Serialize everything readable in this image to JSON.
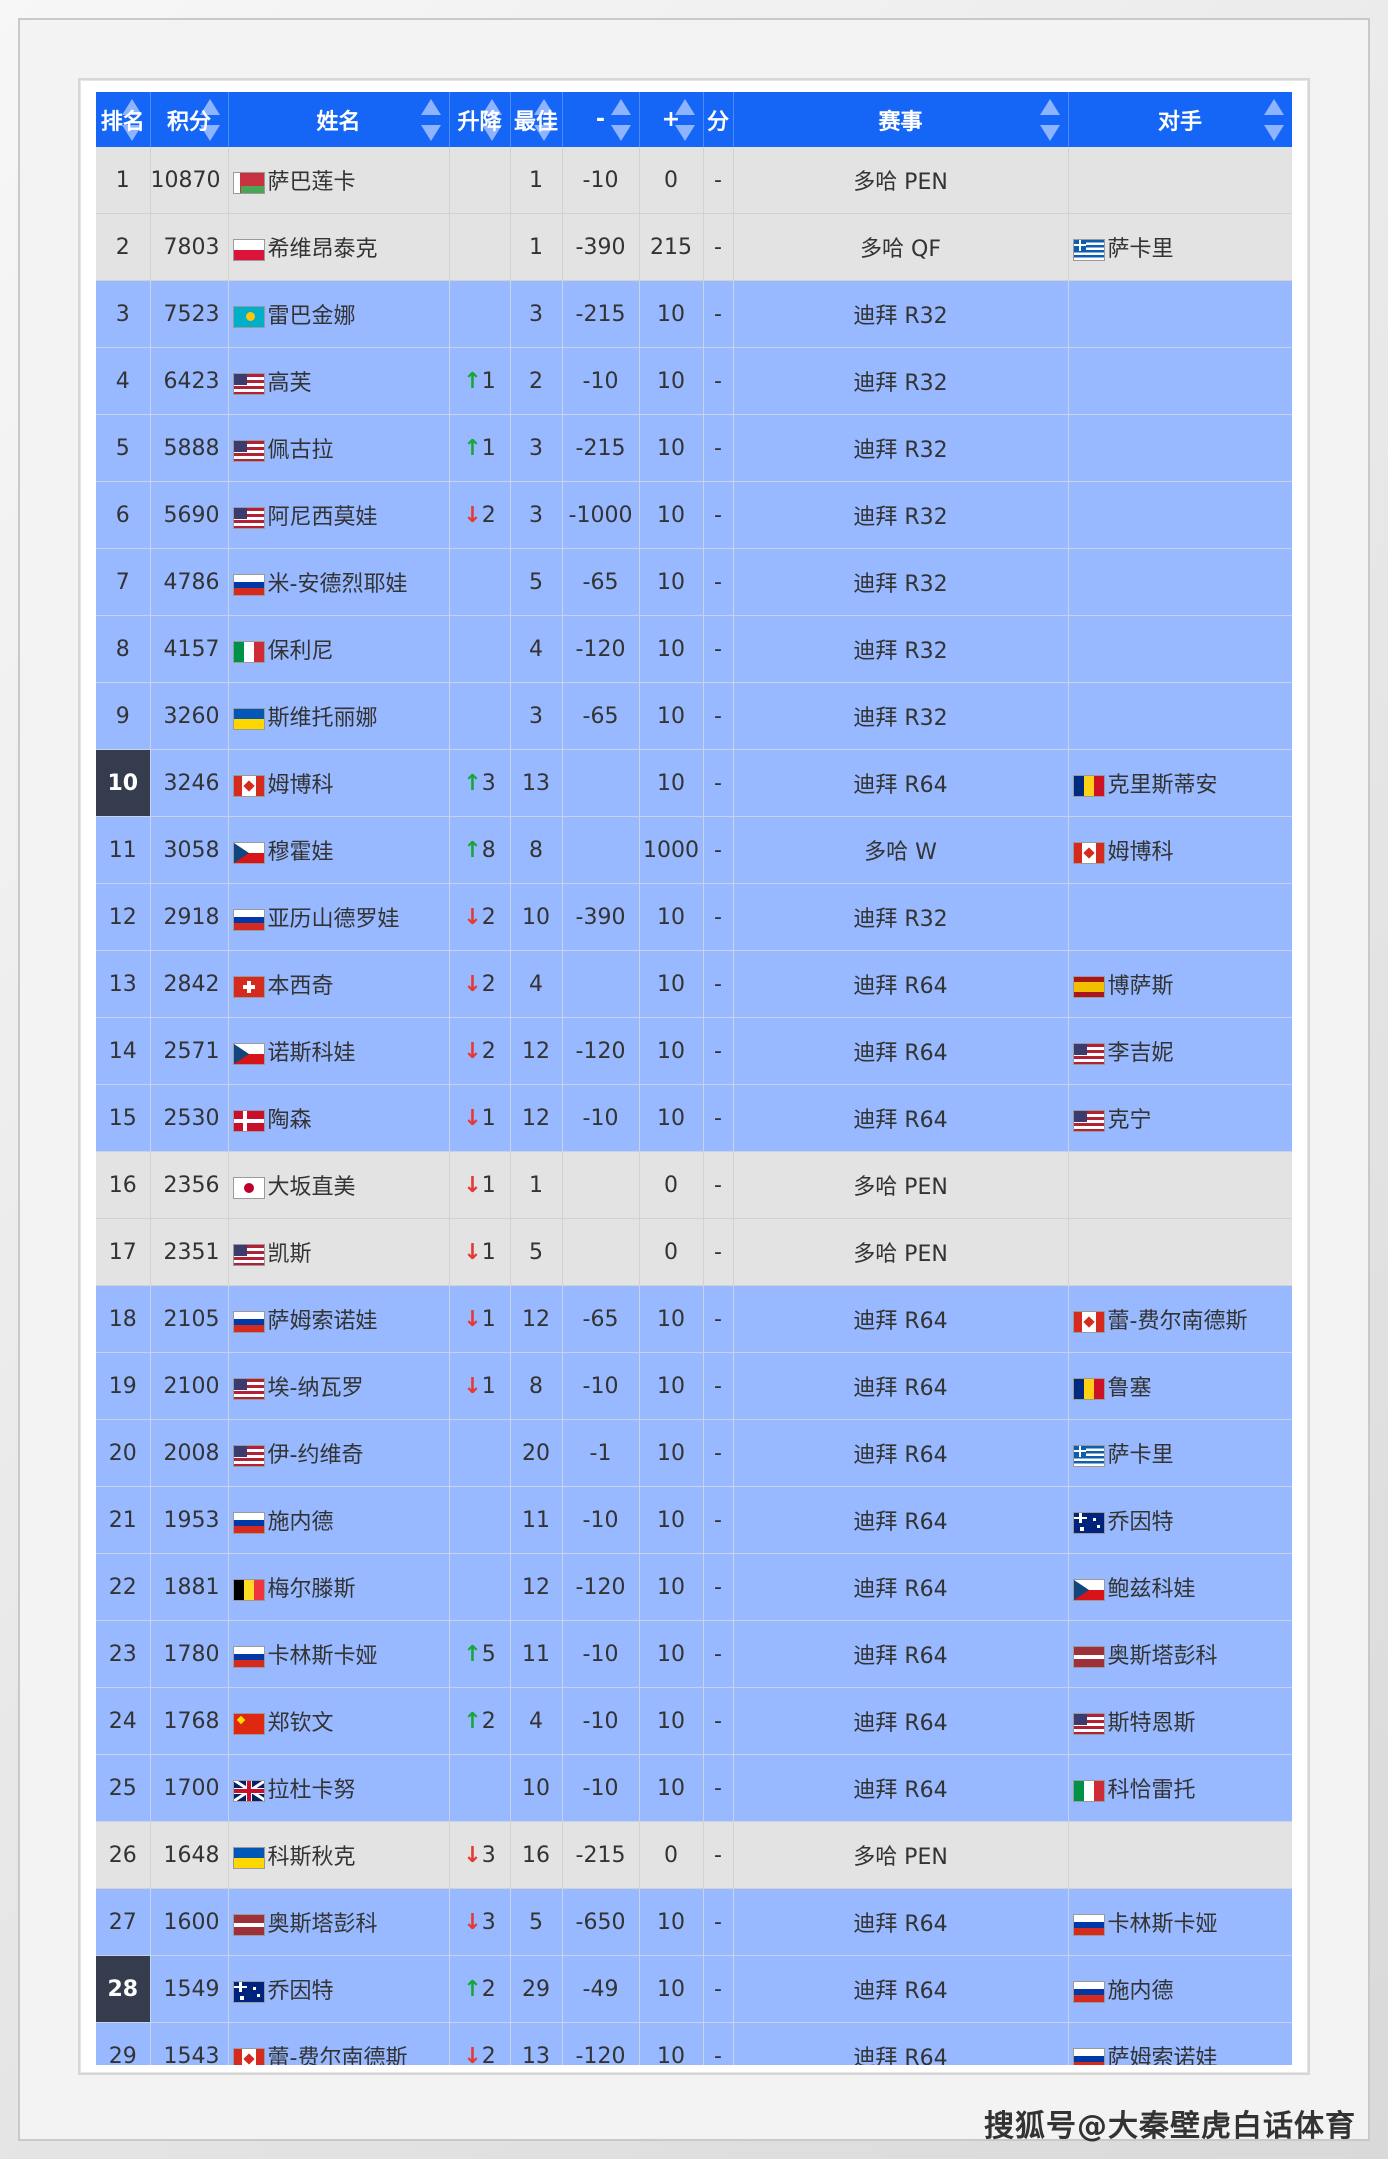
{
  "headers": {
    "rank": "排名",
    "points": "积分",
    "name": "姓名",
    "move": "升降",
    "best": "最佳",
    "drop": "-",
    "add": "+",
    "dash": "分",
    "event": "赛事",
    "opponent": "对手"
  },
  "rows": [
    {
      "rank": "1",
      "points": "10870",
      "flag": "blr",
      "name": "萨巴莲卡",
      "dir": "",
      "move": "",
      "best": "1",
      "drop": "-10",
      "add": "0",
      "dash": "-",
      "event": "多哈 PEN",
      "opp_flag": "",
      "opponent": "",
      "style": "gray",
      "hl": false
    },
    {
      "rank": "2",
      "points": "7803",
      "flag": "pol",
      "name": "希维昂泰克",
      "dir": "",
      "move": "",
      "best": "1",
      "drop": "-390",
      "add": "215",
      "dash": "-",
      "event": "多哈 QF",
      "opp_flag": "gre",
      "opponent": "萨卡里",
      "style": "gray",
      "hl": false
    },
    {
      "rank": "3",
      "points": "7523",
      "flag": "kaz",
      "name": "雷巴金娜",
      "dir": "",
      "move": "",
      "best": "3",
      "drop": "-215",
      "add": "10",
      "dash": "-",
      "event": "迪拜 R32",
      "opp_flag": "",
      "opponent": "",
      "style": "blue",
      "hl": false
    },
    {
      "rank": "4",
      "points": "6423",
      "flag": "usa",
      "name": "高芙",
      "dir": "up",
      "move": "1",
      "best": "2",
      "drop": "-10",
      "add": "10",
      "dash": "-",
      "event": "迪拜 R32",
      "opp_flag": "",
      "opponent": "",
      "style": "blue",
      "hl": false
    },
    {
      "rank": "5",
      "points": "5888",
      "flag": "usa",
      "name": "佩古拉",
      "dir": "up",
      "move": "1",
      "best": "3",
      "drop": "-215",
      "add": "10",
      "dash": "-",
      "event": "迪拜 R32",
      "opp_flag": "",
      "opponent": "",
      "style": "blue",
      "hl": false
    },
    {
      "rank": "6",
      "points": "5690",
      "flag": "usa",
      "name": "阿尼西莫娃",
      "dir": "down",
      "move": "2",
      "best": "3",
      "drop": "-1000",
      "add": "10",
      "dash": "-",
      "event": "迪拜 R32",
      "opp_flag": "",
      "opponent": "",
      "style": "blue",
      "hl": false
    },
    {
      "rank": "7",
      "points": "4786",
      "flag": "rus",
      "name": "米-安德烈耶娃",
      "dir": "",
      "move": "",
      "best": "5",
      "drop": "-65",
      "add": "10",
      "dash": "-",
      "event": "迪拜 R32",
      "opp_flag": "",
      "opponent": "",
      "style": "blue",
      "hl": false
    },
    {
      "rank": "8",
      "points": "4157",
      "flag": "ita",
      "name": "保利尼",
      "dir": "",
      "move": "",
      "best": "4",
      "drop": "-120",
      "add": "10",
      "dash": "-",
      "event": "迪拜 R32",
      "opp_flag": "",
      "opponent": "",
      "style": "blue",
      "hl": false
    },
    {
      "rank": "9",
      "points": "3260",
      "flag": "ukr",
      "name": "斯维托丽娜",
      "dir": "",
      "move": "",
      "best": "3",
      "drop": "-65",
      "add": "10",
      "dash": "-",
      "event": "迪拜 R32",
      "opp_flag": "",
      "opponent": "",
      "style": "blue",
      "hl": false
    },
    {
      "rank": "10",
      "points": "3246",
      "flag": "can",
      "name": "姆博科",
      "dir": "up",
      "move": "3",
      "best": "13",
      "drop": "",
      "add": "10",
      "dash": "-",
      "event": "迪拜 R64",
      "opp_flag": "rou",
      "opponent": "克里斯蒂安",
      "style": "blue",
      "hl": true
    },
    {
      "rank": "11",
      "points": "3058",
      "flag": "cze",
      "name": "穆霍娃",
      "dir": "up",
      "move": "8",
      "best": "8",
      "drop": "",
      "add": "1000",
      "dash": "-",
      "event": "多哈 W",
      "opp_flag": "can",
      "opponent": "姆博科",
      "style": "blue",
      "hl": false
    },
    {
      "rank": "12",
      "points": "2918",
      "flag": "rus",
      "name": "亚历山德罗娃",
      "dir": "down",
      "move": "2",
      "best": "10",
      "drop": "-390",
      "add": "10",
      "dash": "-",
      "event": "迪拜 R32",
      "opp_flag": "",
      "opponent": "",
      "style": "blue",
      "hl": false
    },
    {
      "rank": "13",
      "points": "2842",
      "flag": "sui",
      "name": "本西奇",
      "dir": "down",
      "move": "2",
      "best": "4",
      "drop": "",
      "add": "10",
      "dash": "-",
      "event": "迪拜 R64",
      "opp_flag": "esp",
      "opponent": "博萨斯",
      "style": "blue",
      "hl": false
    },
    {
      "rank": "14",
      "points": "2571",
      "flag": "cze",
      "name": "诺斯科娃",
      "dir": "down",
      "move": "2",
      "best": "12",
      "drop": "-120",
      "add": "10",
      "dash": "-",
      "event": "迪拜 R64",
      "opp_flag": "usa",
      "opponent": "李吉妮",
      "style": "blue",
      "hl": false
    },
    {
      "rank": "15",
      "points": "2530",
      "flag": "den",
      "name": "陶森",
      "dir": "down",
      "move": "1",
      "best": "12",
      "drop": "-10",
      "add": "10",
      "dash": "-",
      "event": "迪拜 R64",
      "opp_flag": "usa",
      "opponent": "克宁",
      "style": "blue",
      "hl": false
    },
    {
      "rank": "16",
      "points": "2356",
      "flag": "jpn",
      "name": "大坂直美",
      "dir": "down",
      "move": "1",
      "best": "1",
      "drop": "",
      "add": "0",
      "dash": "-",
      "event": "多哈 PEN",
      "opp_flag": "",
      "opponent": "",
      "style": "gray",
      "hl": false
    },
    {
      "rank": "17",
      "points": "2351",
      "flag": "usa",
      "name": "凯斯",
      "dir": "down",
      "move": "1",
      "best": "5",
      "drop": "",
      "add": "0",
      "dash": "-",
      "event": "多哈 PEN",
      "opp_flag": "",
      "opponent": "",
      "style": "gray",
      "hl": false
    },
    {
      "rank": "18",
      "points": "2105",
      "flag": "rus",
      "name": "萨姆索诺娃",
      "dir": "down",
      "move": "1",
      "best": "12",
      "drop": "-65",
      "add": "10",
      "dash": "-",
      "event": "迪拜 R64",
      "opp_flag": "can",
      "opponent": "蕾-费尔南德斯",
      "style": "blue",
      "hl": false
    },
    {
      "rank": "19",
      "points": "2100",
      "flag": "usa",
      "name": "埃-纳瓦罗",
      "dir": "down",
      "move": "1",
      "best": "8",
      "drop": "-10",
      "add": "10",
      "dash": "-",
      "event": "迪拜 R64",
      "opp_flag": "rou",
      "opponent": "鲁塞",
      "style": "blue",
      "hl": false
    },
    {
      "rank": "20",
      "points": "2008",
      "flag": "usa",
      "name": "伊-约维奇",
      "dir": "",
      "move": "",
      "best": "20",
      "drop": "-1",
      "add": "10",
      "dash": "-",
      "event": "迪拜 R64",
      "opp_flag": "gre",
      "opponent": "萨卡里",
      "style": "blue",
      "hl": false
    },
    {
      "rank": "21",
      "points": "1953",
      "flag": "rus",
      "name": "施内德",
      "dir": "",
      "move": "",
      "best": "11",
      "drop": "-10",
      "add": "10",
      "dash": "-",
      "event": "迪拜 R64",
      "opp_flag": "aus",
      "opponent": "乔因特",
      "style": "blue",
      "hl": false
    },
    {
      "rank": "22",
      "points": "1881",
      "flag": "bel",
      "name": "梅尔滕斯",
      "dir": "",
      "move": "",
      "best": "12",
      "drop": "-120",
      "add": "10",
      "dash": "-",
      "event": "迪拜 R64",
      "opp_flag": "cze",
      "opponent": "鲍兹科娃",
      "style": "blue",
      "hl": false
    },
    {
      "rank": "23",
      "points": "1780",
      "flag": "rus",
      "name": "卡林斯卡娅",
      "dir": "up",
      "move": "5",
      "best": "11",
      "drop": "-10",
      "add": "10",
      "dash": "-",
      "event": "迪拜 R64",
      "opp_flag": "lat",
      "opponent": "奥斯塔彭科",
      "style": "blue",
      "hl": false
    },
    {
      "rank": "24",
      "points": "1768",
      "flag": "chn",
      "name": "郑钦文",
      "dir": "up",
      "move": "2",
      "best": "4",
      "drop": "-10",
      "add": "10",
      "dash": "-",
      "event": "迪拜 R64",
      "opp_flag": "usa",
      "opponent": "斯特恩斯",
      "style": "blue",
      "hl": false
    },
    {
      "rank": "25",
      "points": "1700",
      "flag": "gbr",
      "name": "拉杜卡努",
      "dir": "",
      "move": "",
      "best": "10",
      "drop": "-10",
      "add": "10",
      "dash": "-",
      "event": "迪拜 R64",
      "opp_flag": "ita",
      "opponent": "科恰雷托",
      "style": "blue",
      "hl": false
    },
    {
      "rank": "26",
      "points": "1648",
      "flag": "ukr",
      "name": "科斯秋克",
      "dir": "down",
      "move": "3",
      "best": "16",
      "drop": "-215",
      "add": "0",
      "dash": "-",
      "event": "多哈 PEN",
      "opp_flag": "",
      "opponent": "",
      "style": "gray",
      "hl": false
    },
    {
      "rank": "27",
      "points": "1600",
      "flag": "lat",
      "name": "奥斯塔彭科",
      "dir": "down",
      "move": "3",
      "best": "5",
      "drop": "-650",
      "add": "10",
      "dash": "-",
      "event": "迪拜 R64",
      "opp_flag": "rus",
      "opponent": "卡林斯卡娅",
      "style": "blue",
      "hl": false
    },
    {
      "rank": "28",
      "points": "1549",
      "flag": "aus",
      "name": "乔因特",
      "dir": "up",
      "move": "2",
      "best": "29",
      "drop": "-49",
      "add": "10",
      "dash": "-",
      "event": "迪拜 R64",
      "opp_flag": "rus",
      "opponent": "施内德",
      "style": "blue",
      "hl": true
    },
    {
      "rank": "29",
      "points": "1543",
      "flag": "can",
      "name": "蕾-费尔南德斯",
      "dir": "down",
      "move": "2",
      "best": "13",
      "drop": "-120",
      "add": "10",
      "dash": "-",
      "event": "迪拜 R64",
      "opp_flag": "rus",
      "opponent": "萨姆索诺娃",
      "style": "blue",
      "hl": false
    }
  ],
  "arrows": {
    "up": "↑",
    "down": "↓"
  },
  "colors": {
    "header": "#1565f6",
    "row_blue": "#98b9ff",
    "row_gray": "#e3e3e3",
    "highlight_rank": "#343c4e",
    "up": "#1aa53a",
    "down": "#e53935"
  },
  "watermark": "搜狐号@大秦壁虎白话体育"
}
